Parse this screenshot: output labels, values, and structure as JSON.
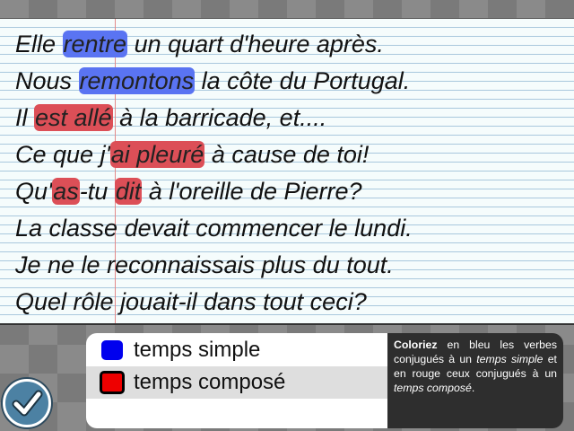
{
  "sentences": [
    [
      {
        "t": "Elle "
      },
      {
        "t": "rentre",
        "c": "blue"
      },
      {
        "t": " un quart d'heure après."
      }
    ],
    [
      {
        "t": "Nous "
      },
      {
        "t": "remontons",
        "c": "blue"
      },
      {
        "t": " la côte du Portugal."
      }
    ],
    [
      {
        "t": "Il "
      },
      {
        "t": "est allé",
        "c": "red"
      },
      {
        "t": " à la barricade, et...."
      }
    ],
    [
      {
        "t": "Ce que j'"
      },
      {
        "t": "ai pleuré",
        "c": "red"
      },
      {
        "t": " à cause de toi!"
      }
    ],
    [
      {
        "t": "Qu'"
      },
      {
        "t": "as",
        "c": "red"
      },
      {
        "t": "-tu "
      },
      {
        "t": "dit",
        "c": "red"
      },
      {
        "t": " à l'oreille de Pierre?"
      }
    ],
    [
      {
        "t": "La classe devait commencer le lundi."
      }
    ],
    [
      {
        "t": "Je ne le reconnaissais plus du tout."
      }
    ],
    [
      {
        "t": "Quel rôle jouait-il dans tout ceci?"
      }
    ]
  ],
  "legend": {
    "simple_label": "temps simple",
    "compose_label": "temps composé",
    "simple_color": "#0000ee",
    "compose_color": "#ee0000"
  },
  "instructions": {
    "bold": "Coloriez",
    "p1": " en bleu les verbes conjugués à un ",
    "i1": "temps simple",
    "p2": " et en rouge ceux conjugués à un ",
    "i2": "temps composé",
    "p3": "."
  },
  "check_button_icon": "checkmark-icon"
}
